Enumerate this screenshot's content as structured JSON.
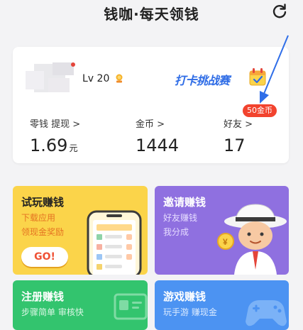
{
  "header": {
    "title": "钱咖·每天领钱",
    "refresh_icon": "refresh-icon"
  },
  "profile": {
    "level": "Lv 20",
    "checkin_banner": "打卡挑战赛"
  },
  "stats": {
    "change": {
      "label": "零钱 提现 >",
      "value": "1.69",
      "unit": "元"
    },
    "coins": {
      "label": "金币 >",
      "value": "1444"
    },
    "friends": {
      "label": "好友 >",
      "value": "17",
      "badge": "50金币"
    }
  },
  "tiles": {
    "try": {
      "title": "试玩赚钱",
      "line1": "下载应用",
      "line2": "领现金奖励",
      "button": "GO!"
    },
    "invite": {
      "title": "邀请赚钱",
      "line1": "好友赚钱",
      "line2": "我分成"
    },
    "register": {
      "title": "注册赚钱",
      "line1": "步骤简单 审核快"
    },
    "game": {
      "title": "游戏赚钱",
      "line1": "玩手游 赚现金"
    }
  },
  "colors": {
    "try_tile": "#fbd44a",
    "invite_tile": "#8f70e0",
    "register_tile": "#33c46e",
    "game_tile": "#4c93f2",
    "badge": "#f2432e",
    "annotation_arrow": "#2f6ee8"
  }
}
